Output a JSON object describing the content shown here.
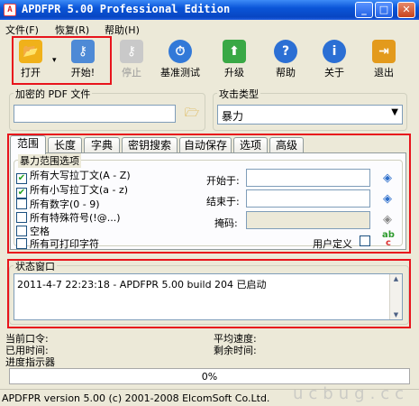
{
  "window": {
    "title": "APDFPR 5.00 Professional Edition",
    "app_icon": "pdf-icon"
  },
  "menu": [
    "文件(F)",
    "恢复(R)",
    "帮助(H)"
  ],
  "toolbar": {
    "open": "打开",
    "start": "开始!",
    "stop": "停止",
    "benchmark": "基准测试",
    "upgrade": "升级",
    "help": "帮助",
    "about": "关于",
    "exit": "退出"
  },
  "pdf": {
    "label": "加密的 PDF 文件",
    "value": ""
  },
  "attack": {
    "label": "攻击类型",
    "value": "暴力"
  },
  "tabs": [
    "范围",
    "长度",
    "字典",
    "密钥搜索",
    "自动保存",
    "选项",
    "高级"
  ],
  "range": {
    "group_label": "暴力范围选项",
    "options": [
      {
        "label": "所有大写拉丁文(A - Z)",
        "checked": true
      },
      {
        "label": "所有小写拉丁文(a - z)",
        "checked": true
      },
      {
        "label": "所有数字(0 - 9)",
        "checked": false
      },
      {
        "label": "所有特殊符号(!@...)",
        "checked": false
      },
      {
        "label": "空格",
        "checked": false
      },
      {
        "label": "所有可打印字符",
        "checked": false
      }
    ],
    "start_label": "开始于:",
    "end_label": "结束于:",
    "mask_label": "掩码:",
    "user_defined_label": "用户定义"
  },
  "status": {
    "label": "状态窗口",
    "log": "2011-4-7 22:23:18 - APDFPR 5.00 build 204 已启动"
  },
  "info": {
    "current_password": "当前口令:",
    "avg_speed": "平均速度:",
    "time_elapsed": "已用时间:",
    "time_left": "剩余时间:",
    "progress_label": "进度指示器"
  },
  "progress": {
    "percent": 0,
    "text": "0%"
  },
  "statusbar": "APDFPR version 5.00 (c) 2001-2008 ElcomSoft Co.Ltd.",
  "watermark": "ucbug.cc",
  "colors": {
    "title_blue": "#0a55d8",
    "highlight_red": "#e8141c",
    "bg": "#ece9d8"
  }
}
